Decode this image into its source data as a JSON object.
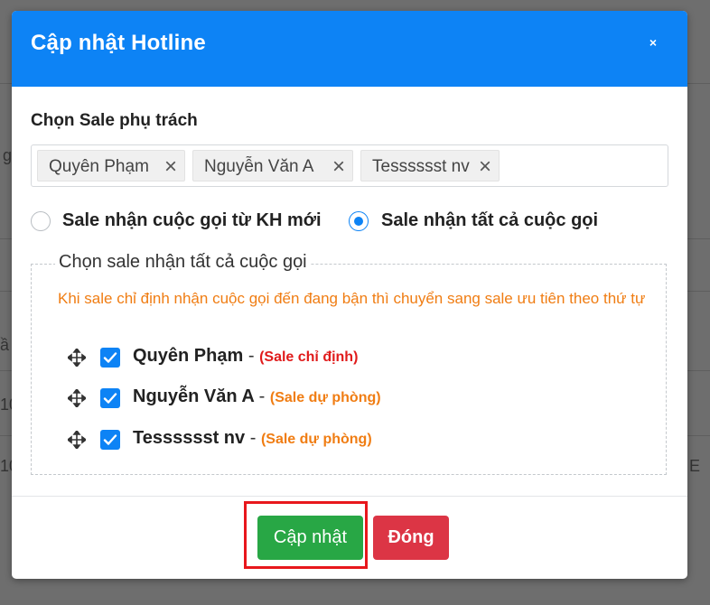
{
  "background": {
    "fragments": [
      "g",
      "ầ",
      "10",
      "10",
      "E"
    ]
  },
  "modal": {
    "title": "Cập nhật Hotline",
    "close_icon": "×",
    "select_label": "Chọn Sale phụ trách",
    "selected_sales": [
      "Quyên Phạm",
      "Nguyễn Văn A",
      "Tesssssst nv"
    ],
    "tag_remove_icon": "×",
    "radio_options": [
      {
        "label": "Sale nhận cuộc gọi từ KH mới",
        "checked": false
      },
      {
        "label": "Sale nhận tất cả cuộc gọi",
        "checked": true
      }
    ],
    "fieldset_legend": "Chọn sale nhận tất cả cuộc gọi",
    "hint": "Khi sale chỉ định nhận cuộc gọi đến đang bận thì chuyển sang sale ưu tiên theo thứ tự",
    "sale_list": [
      {
        "name": "Quyên Phạm",
        "separator": "-",
        "role": "(Sale chỉ định)",
        "role_type": "main",
        "checked": true
      },
      {
        "name": "Nguyễn Văn A",
        "separator": "-",
        "role": "(Sale dự phòng)",
        "role_type": "backup",
        "checked": true
      },
      {
        "name": "Tesssssst nv",
        "separator": "-",
        "role": "(Sale dự phòng)",
        "role_type": "backup",
        "checked": true
      }
    ],
    "buttons": {
      "update": "Cập nhật",
      "close": "Đóng"
    }
  },
  "colors": {
    "header": "#0d83f5",
    "primary": "#0d83f5",
    "success": "#28a745",
    "danger": "#dc3545",
    "hint": "#f07d13",
    "role_main": "#e01b1b",
    "highlight": "#e8171c"
  },
  "icons": {
    "close": "close-icon",
    "tag_remove": "remove-tag-icon",
    "drag": "move-icon",
    "check": "check-icon"
  }
}
